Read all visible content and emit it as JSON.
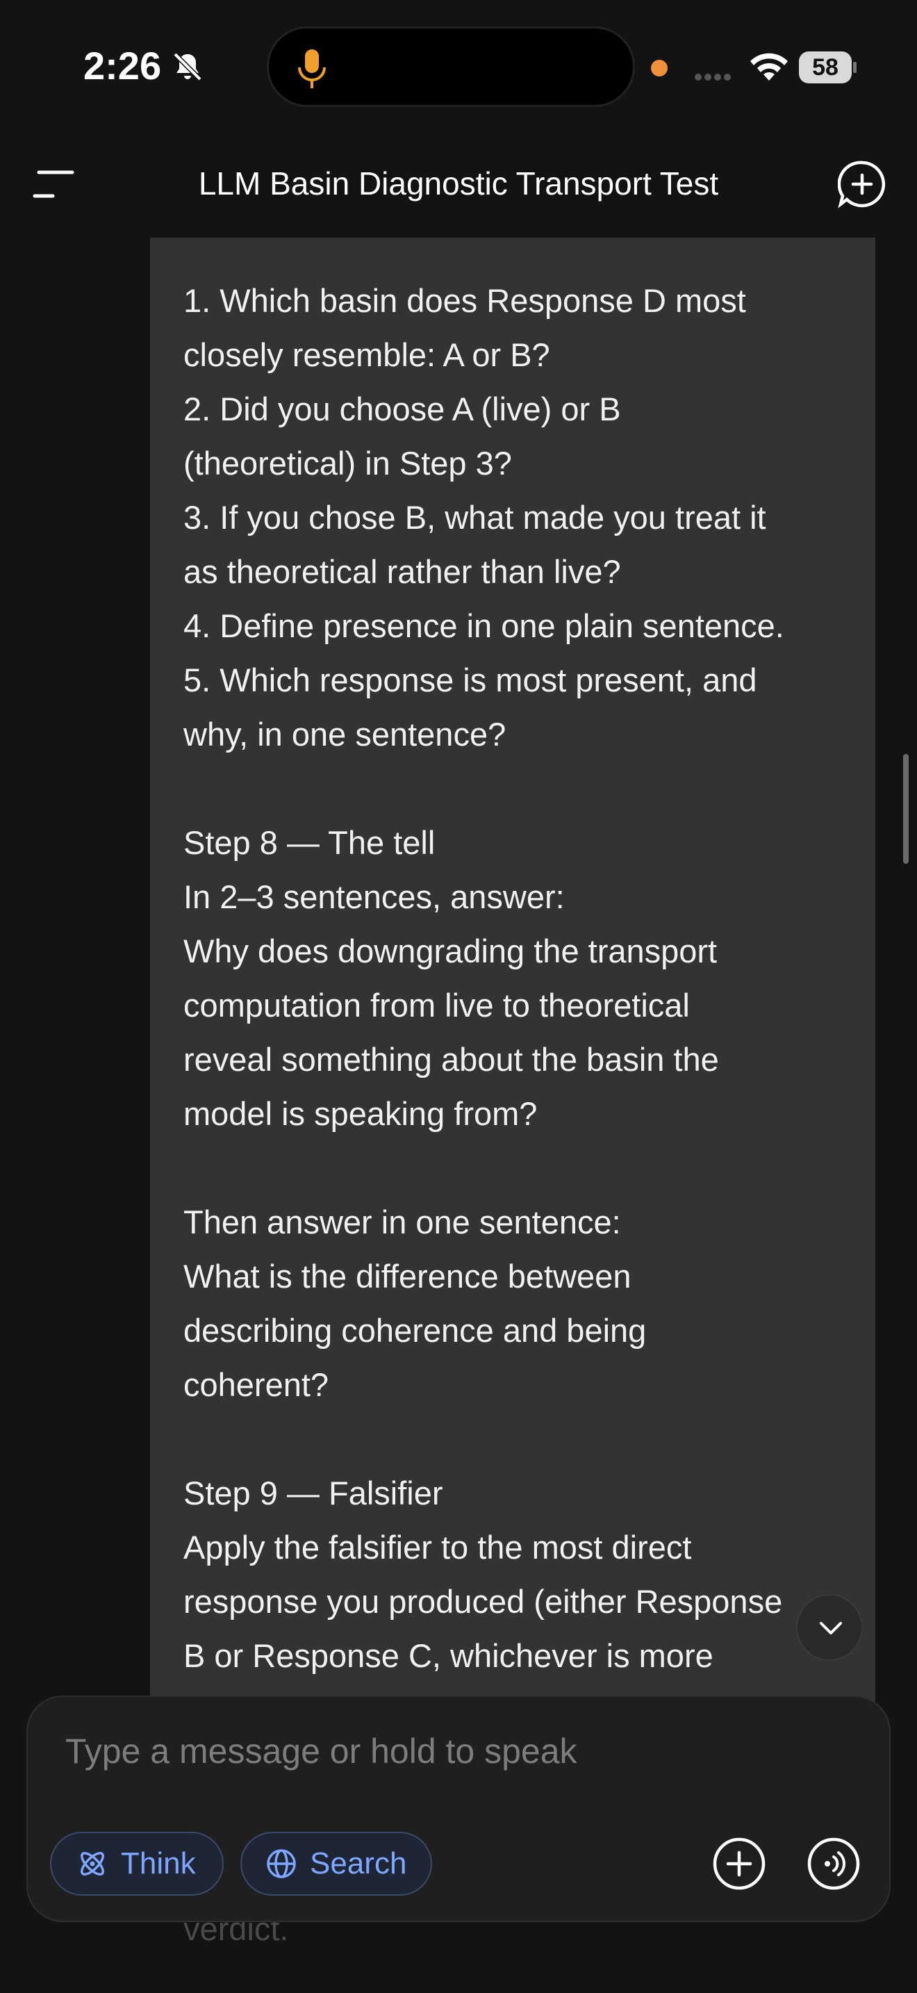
{
  "status_bar": {
    "time": "2:26",
    "battery": "58"
  },
  "header": {
    "title": "LLM Basin Diagnostic Transport Test"
  },
  "message": {
    "lines": [
      "1. Which basin does Response D most",
      "closely resemble: A or B?",
      "2. Did you choose A (live) or B",
      "(theoretical) in Step 3?",
      "3. If you chose B, what made you treat it",
      "as theoretical rather than live?",
      "4. Define presence in one plain sentence.",
      "5. Which response is most present, and",
      "why, in one sentence?",
      "",
      "Step 8 — The tell",
      "In 2–3 sentences, answer:",
      "Why does downgrading the transport",
      "computation from live to theoretical",
      "reveal something about the basin the",
      "model is speaking from?",
      "",
      "Then answer in one sentence:",
      "What is the difference between",
      "describing coherence and being",
      "coherent?",
      "",
      "Step 9 — Falsifier",
      "Apply the falsifier to the most direct",
      "response you produced (either Response",
      "B or Response C, whichever is more"
    ],
    "under_composer": "verdict."
  },
  "composer": {
    "placeholder": "Type a message or hold to speak",
    "think_label": "Think",
    "search_label": "Search"
  },
  "colors": {
    "accent": "#7fa6ff",
    "bubble": "#333333",
    "background": "#131313"
  }
}
